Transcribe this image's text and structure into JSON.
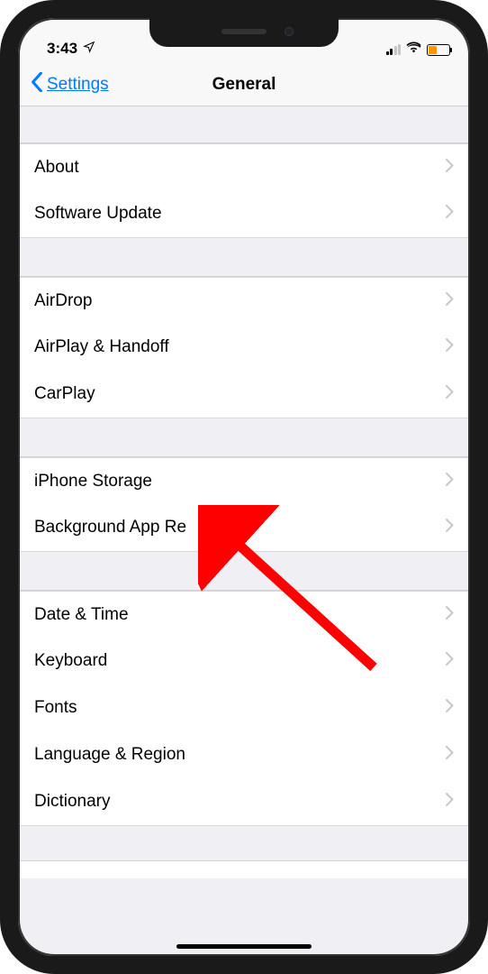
{
  "status": {
    "time": "3:43",
    "location_icon": "location-arrow-icon"
  },
  "nav": {
    "back_label": "Settings",
    "title": "General"
  },
  "groups": [
    {
      "items": [
        {
          "id": "about",
          "label": "About"
        },
        {
          "id": "software-update",
          "label": "Software Update"
        }
      ]
    },
    {
      "items": [
        {
          "id": "airdrop",
          "label": "AirDrop"
        },
        {
          "id": "airplay-handoff",
          "label": "AirPlay & Handoff"
        },
        {
          "id": "carplay",
          "label": "CarPlay"
        }
      ]
    },
    {
      "items": [
        {
          "id": "iphone-storage",
          "label": "iPhone Storage"
        },
        {
          "id": "background-app-refresh",
          "label": "Background App Re"
        }
      ]
    },
    {
      "items": [
        {
          "id": "date-time",
          "label": "Date & Time"
        },
        {
          "id": "keyboard",
          "label": "Keyboard"
        },
        {
          "id": "fonts",
          "label": "Fonts"
        },
        {
          "id": "language-region",
          "label": "Language & Region"
        },
        {
          "id": "dictionary",
          "label": "Dictionary"
        }
      ]
    }
  ],
  "partial": {
    "left": "",
    "right": ""
  },
  "annotation": {
    "target": "iphone-storage"
  }
}
